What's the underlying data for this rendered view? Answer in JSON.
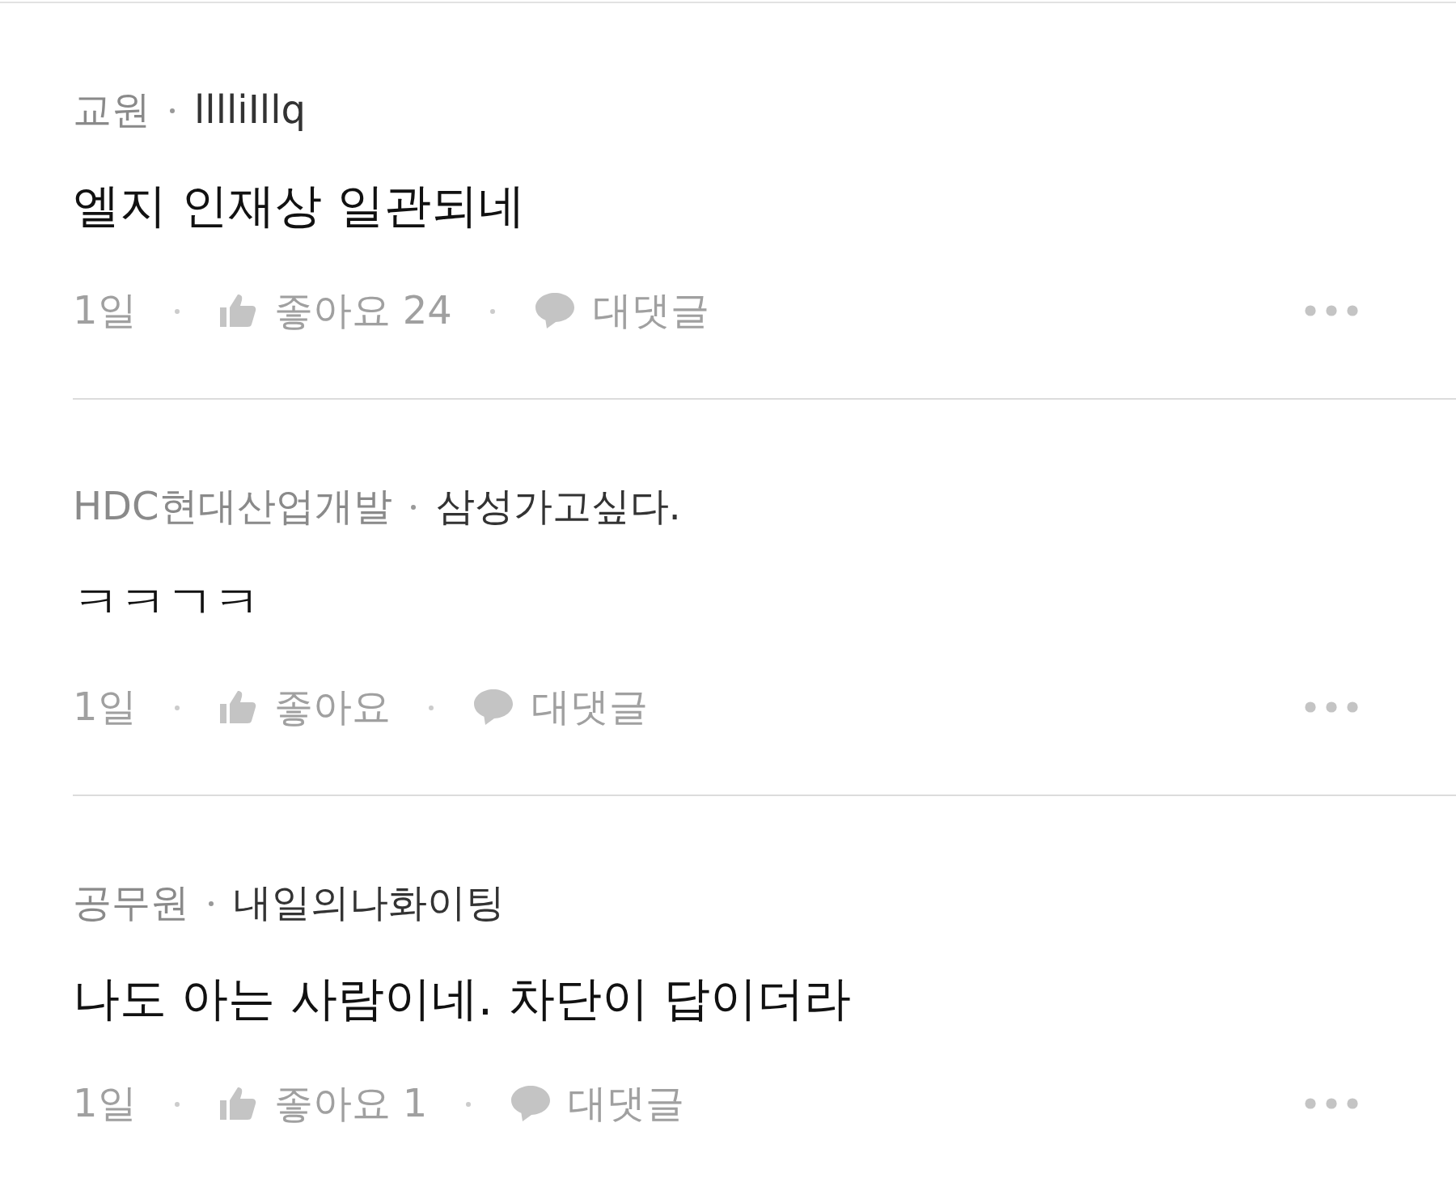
{
  "comments": [
    {
      "affiliation": "교원",
      "nickname": "lllliIllq",
      "body": "엘지 인재상 일관되네",
      "time": "1일",
      "like": "좋아요 24",
      "reply": "대댓글"
    },
    {
      "affiliation": "HDC현대산업개발",
      "nickname": "삼성가고싶다.",
      "body": "ㅋㅋㄱㅋ",
      "time": "1일",
      "like": "좋아요",
      "reply": "대댓글"
    },
    {
      "affiliation": "공무원",
      "nickname": "내일의나화이팅",
      "body": "나도 아는 사람이네. 차단이 답이더라",
      "time": "1일",
      "like": "좋아요 1",
      "reply": "대댓글"
    }
  ]
}
